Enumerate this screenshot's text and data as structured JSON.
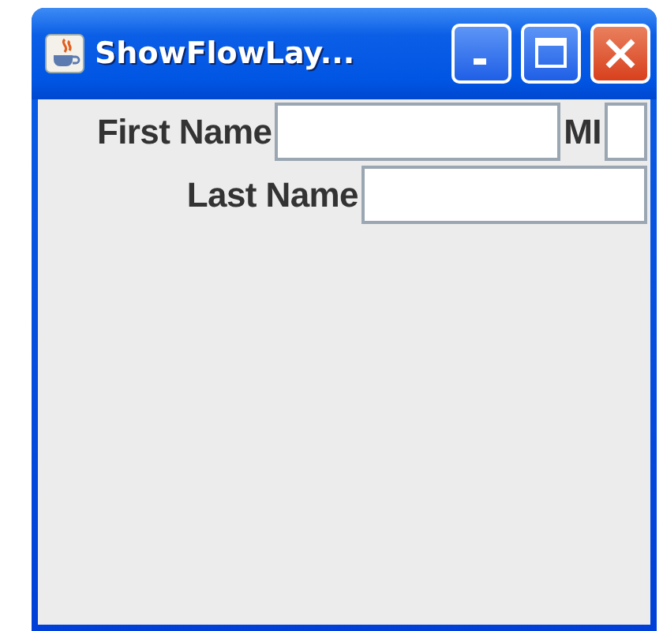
{
  "window": {
    "title": "ShowFlowLay..."
  },
  "rows": [
    {
      "items": [
        {
          "kind": "label",
          "text": "First Name"
        },
        {
          "kind": "field"
        },
        {
          "kind": "label",
          "text": "MI"
        },
        {
          "kind": "minifield"
        }
      ]
    },
    {
      "items": [
        {
          "kind": "label",
          "text": "Last Name"
        },
        {
          "kind": "field"
        }
      ]
    }
  ]
}
